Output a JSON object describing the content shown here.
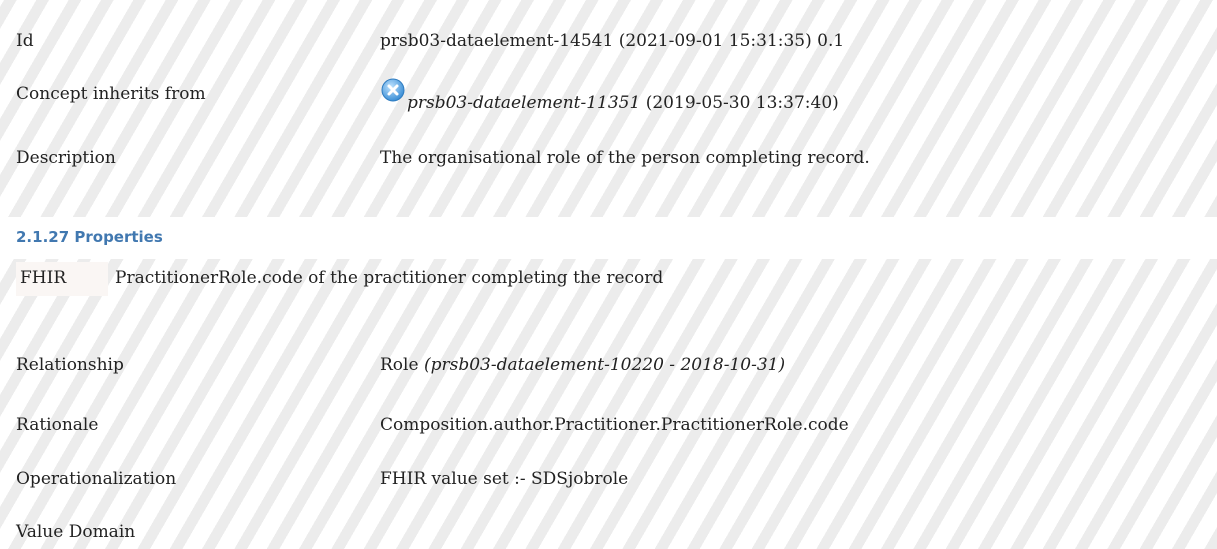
{
  "concept": {
    "id_label": "Id",
    "id_value": "prsb03-dataelement-14541 (2021-09-01 15:31:35) 0.1",
    "inherits_label": "Concept inherits from",
    "inherits_ref": "prsb03-dataelement-11351",
    "inherits_date": "(2019-05-30 13:37:40)",
    "inherits_icon": "remove-circle-icon",
    "description_label": "Description",
    "description_value": "The organisational role of the person completing record."
  },
  "properties": {
    "heading": "2.1.27 Properties",
    "fhir_tag": "FHIR",
    "fhir_text": "PractitionerRole.code of the practitioner completing the record",
    "relationship_label": "Relationship",
    "relationship_name": "Role",
    "relationship_ref": "(prsb03-dataelement-10220 - 2018-10-31)",
    "rationale_label": "Rationale",
    "rationale_value": "Composition.author.Practitioner.PractitionerRole.code",
    "operationalization_label": "Operationalization",
    "operationalization_value": "FHIR value set :- SDSjobrole",
    "value_domain_label": "Value Domain"
  },
  "colors": {
    "heading": "#4178b0",
    "icon": "#5aa9e6"
  }
}
